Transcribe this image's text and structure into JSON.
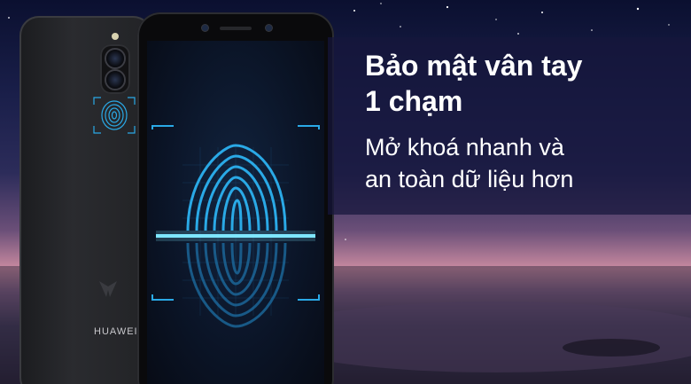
{
  "banner": {
    "headline_line1": "Bảo mật vân tay",
    "headline_line2": "1 chạm",
    "subline_line1": "Mở khoá nhanh và",
    "subline_line2": "an toàn dữ liệu hơn"
  },
  "phone": {
    "brand": "HUAWEI"
  },
  "colors": {
    "panel": "#16163c",
    "fingerprint": "#2aa9e6",
    "scan_line": "#7fe6ff",
    "text": "#ffffff"
  },
  "icons": [
    "fingerprint-icon",
    "scan-frame-icon",
    "camera-icon",
    "brand-logo"
  ]
}
